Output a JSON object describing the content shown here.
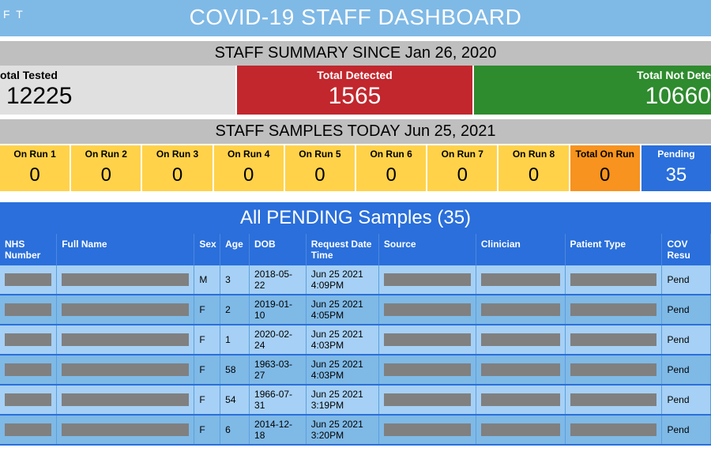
{
  "header": {
    "title": "COVID-19 STAFF DASHBOARD",
    "corner": "F T"
  },
  "summary": {
    "title": "STAFF SUMMARY SINCE Jan 26, 2020",
    "tested_label": "otal Tested",
    "tested_value": "12225",
    "detected_label": "Total Detected",
    "detected_value": "1565",
    "notdetected_label": "Total Not Dete",
    "notdetected_value": "10660"
  },
  "today": {
    "title": "STAFF SAMPLES TODAY Jun 25, 2021",
    "runs": [
      {
        "label": "On Run 1",
        "value": "0"
      },
      {
        "label": "On Run 2",
        "value": "0"
      },
      {
        "label": "On Run 3",
        "value": "0"
      },
      {
        "label": "On Run 4",
        "value": "0"
      },
      {
        "label": "On Run 5",
        "value": "0"
      },
      {
        "label": "On Run 6",
        "value": "0"
      },
      {
        "label": "On Run 7",
        "value": "0"
      },
      {
        "label": "On Run 8",
        "value": "0"
      }
    ],
    "total_label": "Total On Run",
    "total_value": "0",
    "pending_label": "Pending",
    "pending_value": "35"
  },
  "pending": {
    "title": "All PENDING Samples (35)",
    "columns": [
      "NHS Number",
      "Full Name",
      "Sex",
      "Age",
      "DOB",
      "Request Date Time",
      "Source",
      "Clinician",
      "Patient Type",
      "COV Resu"
    ],
    "rows": [
      {
        "sex": "M",
        "age": "3",
        "dob": "2018-05-22",
        "req": "Jun 25 2021 4:09PM",
        "cov": "Pend"
      },
      {
        "sex": "F",
        "age": "2",
        "dob": "2019-01-10",
        "req": "Jun 25 2021 4:05PM",
        "cov": "Pend"
      },
      {
        "sex": "F",
        "age": "1",
        "dob": "2020-02-24",
        "req": "Jun 25 2021 4:03PM",
        "cov": "Pend"
      },
      {
        "sex": "F",
        "age": "58",
        "dob": "1963-03-27",
        "req": "Jun 25 2021 4:03PM",
        "cov": "Pend"
      },
      {
        "sex": "F",
        "age": "54",
        "dob": "1966-07-31",
        "req": "Jun 25 2021 3:19PM",
        "cov": "Pend"
      },
      {
        "sex": "F",
        "age": "6",
        "dob": "2014-12-18",
        "req": "Jun 25 2021 3:20PM",
        "cov": "Pend"
      }
    ]
  }
}
